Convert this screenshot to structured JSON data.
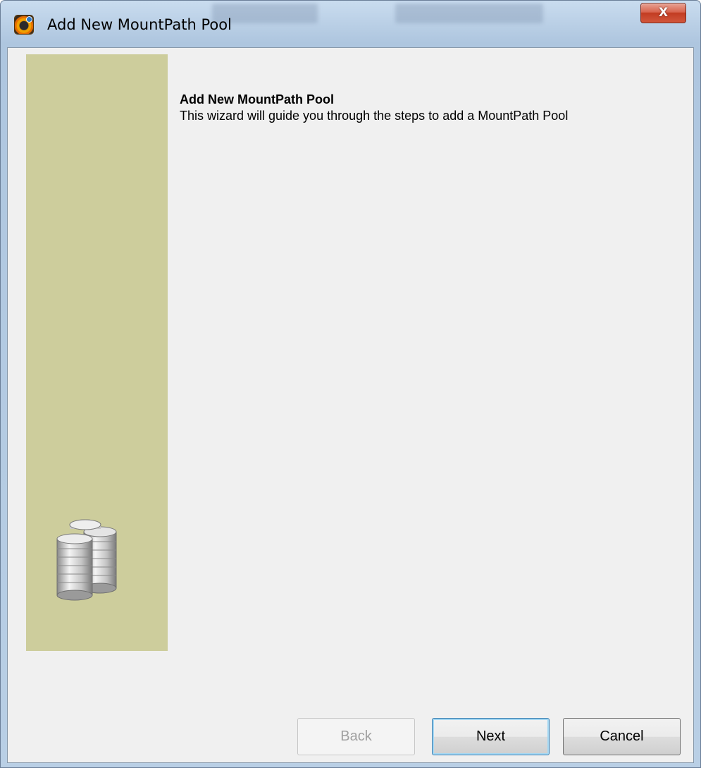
{
  "window": {
    "title": "Add New MountPath Pool",
    "close_glyph": "X",
    "app_icon": "mountpath-app-icon"
  },
  "wizard": {
    "heading": "Add New MountPath Pool",
    "description": "This wizard will guide you through the steps to add a MountPath Pool",
    "side_image": "coin-stacks-icon"
  },
  "buttons": {
    "back": "Back",
    "next": "Next",
    "cancel": "Cancel"
  },
  "colors": {
    "side_panel": "#cdcd9c",
    "client_background": "#f0f0f0",
    "close_button": "#c8402a"
  }
}
